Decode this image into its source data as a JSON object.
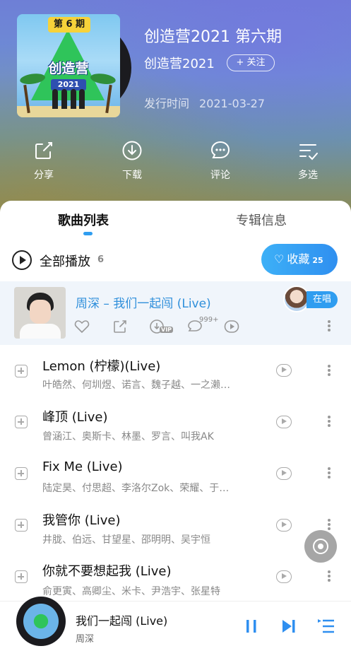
{
  "album": {
    "title": "创造营2021 第六期",
    "artist": "创造营2021",
    "follow_label": "+ 关注",
    "release_label": "发行时间",
    "release_date": "2021-03-27",
    "cover": {
      "badge": "第 6 期",
      "logo": "创造营",
      "year": "2021"
    }
  },
  "actions": [
    {
      "label": "分享",
      "icon": "share-icon"
    },
    {
      "label": "下载",
      "icon": "download-icon"
    },
    {
      "label": "评论",
      "icon": "comment-icon"
    },
    {
      "label": "多选",
      "icon": "multi-select-icon"
    }
  ],
  "tabs": [
    {
      "label": "歌曲列表",
      "active": true
    },
    {
      "label": "专辑信息",
      "active": false
    }
  ],
  "play_all": {
    "label": "全部播放",
    "count": "6"
  },
  "collect": {
    "label": "收藏",
    "count": "25"
  },
  "now_playing_row": {
    "title": "周深 – 我们一起闯 (Live)",
    "comment_count": "999+",
    "vip_badge": "VIP",
    "singing_label": "在唱"
  },
  "songs": [
    {
      "title": "Lemon (柠檬)(Live)",
      "artists": "叶皓然、何圳煜、诺言、魏子越、一之濑…"
    },
    {
      "title": "峰顶 (Live)",
      "artists": "曾涵江、奥斯卡、林墨、罗言、叫我AK"
    },
    {
      "title": "Fix Me (Live)",
      "artists": "陆定昊、付思超、李洛尔Zok、荣耀、于…"
    },
    {
      "title": "我管你 (Live)",
      "artists": "井胧、伯远、甘望星、邵明明、吴宇恒"
    },
    {
      "title": "你就不要想起我 (Live)",
      "artists": "俞更寅、高卿尘、米卡、尹浩宇、张星特"
    }
  ],
  "player": {
    "title": "我们一起闯 (Live)",
    "artist": "周深"
  },
  "colors": {
    "accent": "#2f9df0",
    "now_title": "#2f8fdb"
  }
}
